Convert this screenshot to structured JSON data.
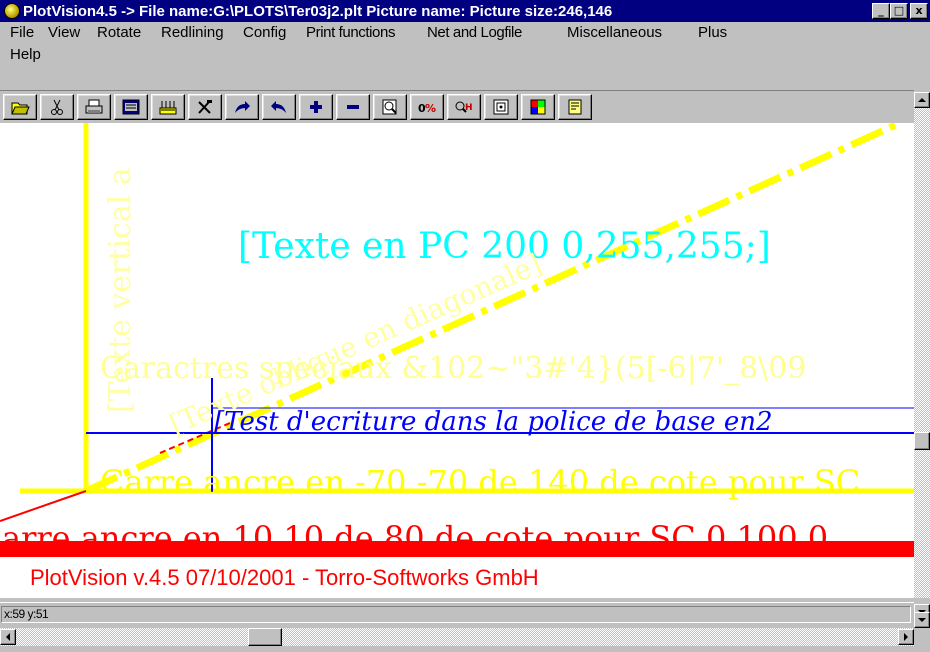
{
  "window": {
    "title": "PlotVision4.5 -> File name:G:\\PLOTS\\Ter03j2.plt Picture name: Picture size:246,146",
    "controls": [
      "_",
      "□",
      "x"
    ]
  },
  "menu": {
    "items": [
      {
        "label": "File"
      },
      {
        "label": "View"
      },
      {
        "label": "Rotate"
      },
      {
        "label": "Redlining"
      },
      {
        "label": "Config"
      },
      {
        "label": "Print functions"
      },
      {
        "label": "Net and Logfile"
      },
      {
        "label": "Miscellaneous"
      },
      {
        "label": "Plus"
      },
      {
        "label": "Help"
      }
    ]
  },
  "toolbar": {
    "buttons": [
      {
        "icon": "open-folder-icon"
      },
      {
        "icon": "scissors-icon"
      },
      {
        "icon": "printer-icon"
      },
      {
        "icon": "print-preview-icon"
      },
      {
        "icon": "plotter-icon"
      },
      {
        "icon": "tools-icon"
      },
      {
        "icon": "redo-arrow-icon"
      },
      {
        "icon": "undo-arrow-icon"
      },
      {
        "icon": "zoom-in-plus-icon"
      },
      {
        "icon": "zoom-out-minus-icon"
      },
      {
        "icon": "magnifier-icon"
      },
      {
        "icon": "zoom-percent-icon"
      },
      {
        "icon": "magnifier-key-icon"
      },
      {
        "icon": "fit-window-icon"
      },
      {
        "icon": "layers-color-icon"
      },
      {
        "icon": "info-sheet-icon"
      }
    ]
  },
  "drawing": {
    "text_cyan": "[Texte en PC 200 0,255,255;]",
    "text_vertical": "[Texte vertical a",
    "text_diagonal": "[Texte oblique en diagonale]",
    "text_specials": "Caract",
    "text_specials_rest": "res speciaux &102~\"3#'4}(5[-6|",
    "text_specials_tail": "7'_8\\09",
    "text_blue": "[Test d'ecriture dans la police de base en",
    "text_blue_tail": "2",
    "text_yellow_line": "Carre ancre en -70 -70 de 140 de cote pour SC",
    "text_red_line": "arre ancre en 10 10 de 80 de cote pour SC 0 100 0",
    "footer_text": "PlotVision v.4.5 07/10/2001 - Torro-Softworks GmbH",
    "colors": {
      "yellow": "#ffff00",
      "cyan": "#00ffff",
      "blue": "#0000ff",
      "red": "#ff0000",
      "lightyellow": "#ffffa0"
    }
  },
  "status": {
    "coords": "x:59 y:51"
  }
}
